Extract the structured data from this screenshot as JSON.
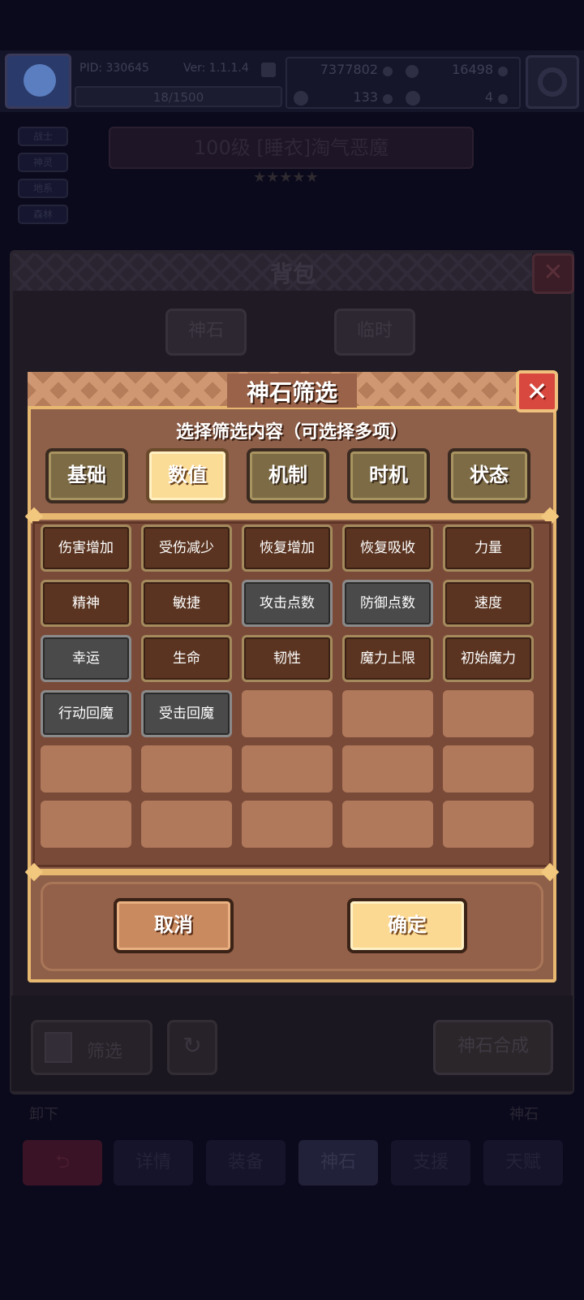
{
  "top_bar": {
    "pid": "PID: 330645",
    "version": "Ver: 1.1.1.4",
    "xp": "18/1500",
    "currency1": "7377802",
    "currency2": "16498",
    "currency3": "133",
    "currency4": "4"
  },
  "side_tags": [
    "战士",
    "神灵",
    "地系",
    "森林"
  ],
  "unit_title": "100级 [睡衣]淘气恶魔",
  "stars": "★★★★★",
  "backpack": {
    "title": "背包",
    "close_icon": "close-icon",
    "tabs": [
      "神石",
      "临时"
    ],
    "filter_label": "筛选",
    "compose_label": "神石合成",
    "unequip_label": "卸下",
    "godstone_label": "神石"
  },
  "nav": [
    "详情",
    "装备",
    "神石",
    "支援",
    "天赋"
  ],
  "dialog": {
    "title": "神石筛选",
    "subtitle": "选择筛选内容（可选择多项）",
    "categories": [
      "基础",
      "数值",
      "机制",
      "时机",
      "状态"
    ],
    "active_category": "数值",
    "options": [
      {
        "label": "伤害增加",
        "style": "brown"
      },
      {
        "label": "受伤减少",
        "style": "brown"
      },
      {
        "label": "恢复增加",
        "style": "brown"
      },
      {
        "label": "恢复吸收",
        "style": "brown"
      },
      {
        "label": "力量",
        "style": "brown"
      },
      {
        "label": "精神",
        "style": "brown"
      },
      {
        "label": "敏捷",
        "style": "brown"
      },
      {
        "label": "攻击点数",
        "style": "gray"
      },
      {
        "label": "防御点数",
        "style": "gray"
      },
      {
        "label": "速度",
        "style": "brown"
      },
      {
        "label": "幸运",
        "style": "gray"
      },
      {
        "label": "生命",
        "style": "brown"
      },
      {
        "label": "韧性",
        "style": "brown"
      },
      {
        "label": "魔力上限",
        "style": "brown"
      },
      {
        "label": "初始魔力",
        "style": "brown"
      },
      {
        "label": "行动回魔",
        "style": "gray"
      },
      {
        "label": "受击回魔",
        "style": "gray"
      }
    ],
    "cancel_label": "取消",
    "confirm_label": "确定"
  },
  "colors": {
    "dialog_bg": "#8e5f49",
    "gold_border": "#e7b86f",
    "active_tab": "#fbdc96",
    "close_red": "#d8483f"
  }
}
